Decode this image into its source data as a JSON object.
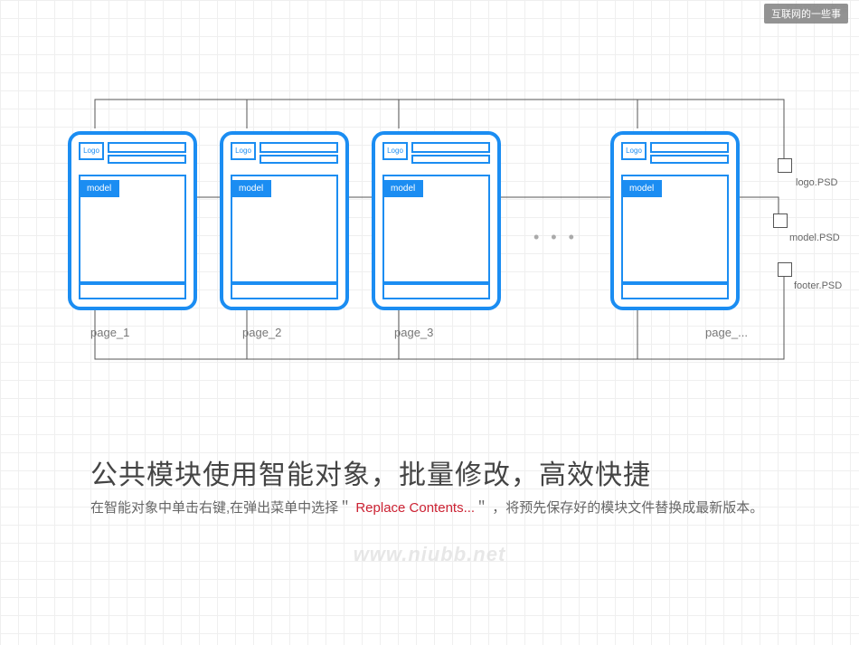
{
  "tag_faint": "互联网的一些事",
  "tag": "互联网的一些事",
  "card": {
    "logo": "Logo",
    "model": "model"
  },
  "pages": {
    "p1": "page_1",
    "p2": "page_2",
    "p3": "page_3",
    "pN": "page_..."
  },
  "dots": "• • •",
  "files": {
    "logo": "logo.PSD",
    "model": "model.PSD",
    "footer": "footer.PSD"
  },
  "heading": "公共模块使用智能对象，批量修改，高效快捷",
  "desc_a": "在智能对象中单击右键,在弹出菜单中选择＂",
  "desc_menu": " Replace Contents...",
  "desc_b": "＂ ，将预先保存好的模块文件替换成最新版本。",
  "watermark": "www.niubb.net"
}
